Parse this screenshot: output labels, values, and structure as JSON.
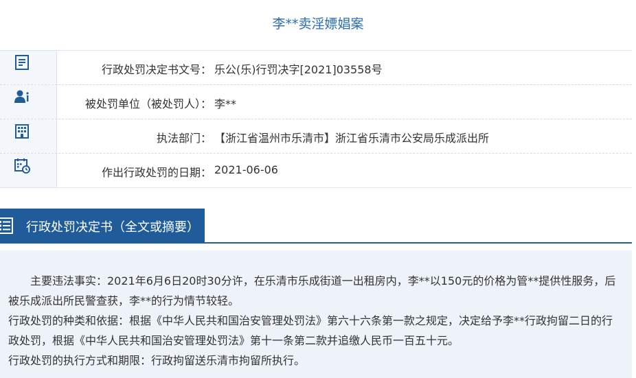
{
  "title": "李**卖淫嫖娼案",
  "info_rows": [
    {
      "icon": "document-icon",
      "label": "行政处罚决定书文号：",
      "value": "乐公(乐)行罚决字[2021]03558号"
    },
    {
      "icon": "person-icon",
      "label": "被处罚单位（被处罚人）：",
      "value": "李**"
    },
    {
      "icon": "building-icon",
      "label": "执法部门：",
      "value": "【浙江省温州市乐清市】浙江省乐清市公安局乐成派出所"
    },
    {
      "icon": "calendar-icon",
      "label": "作出行政处罚的日期：",
      "value": "2021-06-06"
    }
  ],
  "section": {
    "title": "行政处罚决定书（全文或摘要）",
    "icon": "list-icon"
  },
  "content": {
    "p1": "　　主要违法事实：2021年6月6日20时30分许，在乐清市乐成街道一出租房内，李**以150元的价格为管**提供性服务，后被乐成派出所民警查获，李**的行为情节较轻。",
    "p2": "行政处罚的种类和依据：根据《中华人民共和国治安管理处罚法》第六十六条第一款之规定，决定给予李**行政拘留二日的行政处罚，根据《中华人民共和国治安管理处罚法》第十一条第二款并追缴人民币一百五十元。",
    "p3": "行政处罚的执行方式和期限：行政拘留送乐清市拘留所执行。"
  },
  "colors": {
    "accent": "#1f5c99",
    "title": "#2b6cb0",
    "content_bg": "#eef3f9"
  }
}
